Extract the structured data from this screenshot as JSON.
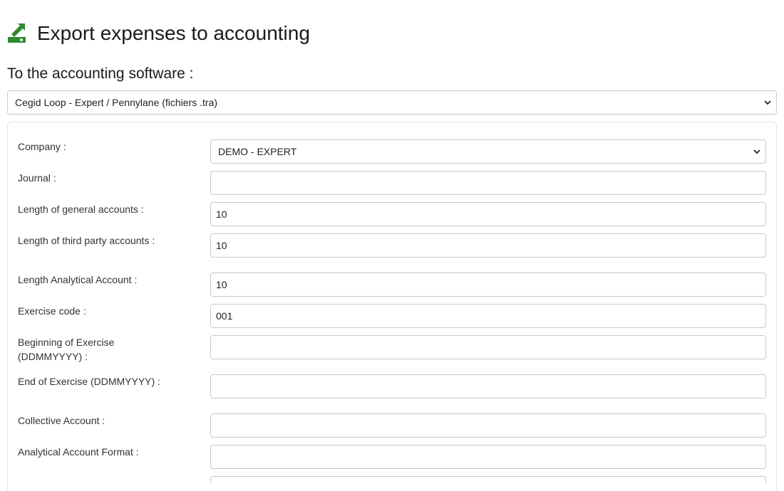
{
  "header": {
    "title": "Export expenses to accounting",
    "icon": "export-icon",
    "icon_color": "#2e8b2e"
  },
  "software": {
    "label": "To the accounting software :",
    "selected": "Cegid Loop - Expert / Pennylane (fichiers .tra)"
  },
  "form": {
    "company_label": "Company :",
    "company_value": "DEMO - EXPERT",
    "journal_label": "Journal :",
    "journal_value": "",
    "general_accounts_label": "Length of general accounts :",
    "general_accounts_value": "10",
    "third_party_label": "Length of third party accounts :",
    "third_party_value": "10",
    "analytical_length_label": "Length Analytical Account :",
    "analytical_length_value": "10",
    "exercise_code_label": "Exercise code :",
    "exercise_code_value": "001",
    "beginning_label": "Beginning of Exercise (DDMMYYYY) :",
    "beginning_value": "",
    "end_label": "End of Exercise (DDMMYYYY) :",
    "end_value": "",
    "collective_label": "Collective Account :",
    "collective_value": "",
    "analytical_format_label": "Analytical Account Format :",
    "analytical_format_value": ""
  }
}
